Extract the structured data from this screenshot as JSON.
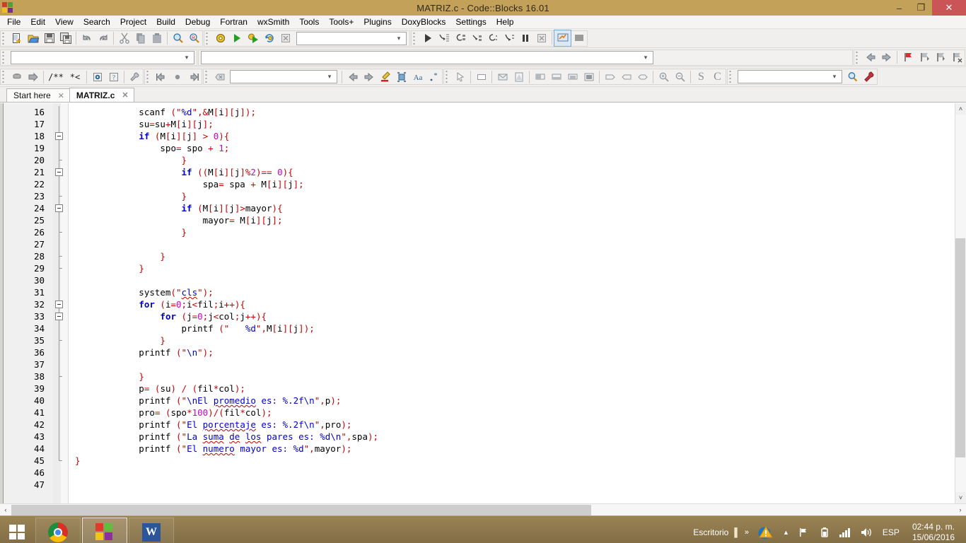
{
  "window": {
    "title": "MATRIZ.c - Code::Blocks 16.01",
    "logo_icon": "codeblocks-logo-icon",
    "minimize": "–",
    "maximize": "❐",
    "close": "✕",
    "titlebar_color": "#c3a158",
    "close_color": "#cb5456"
  },
  "menubar": {
    "items": [
      {
        "label": "File"
      },
      {
        "label": "Edit"
      },
      {
        "label": "View"
      },
      {
        "label": "Search"
      },
      {
        "label": "Project"
      },
      {
        "label": "Build"
      },
      {
        "label": "Debug"
      },
      {
        "label": "Fortran"
      },
      {
        "label": "wxSmith"
      },
      {
        "label": "Tools"
      },
      {
        "label": "Tools+"
      },
      {
        "label": "Plugins"
      },
      {
        "label": "DoxyBlocks"
      },
      {
        "label": "Settings"
      },
      {
        "label": "Help"
      }
    ]
  },
  "toolbars": {
    "row1": {
      "file_buttons": [
        "new-file-icon",
        "open-file-icon",
        "save-icon",
        "save-all-icon"
      ],
      "undo_buttons": [
        "undo-icon",
        "redo-icon"
      ],
      "clipboard_buttons": [
        "cut-icon",
        "copy-icon",
        "paste-icon"
      ],
      "find_buttons": [
        "find-icon",
        "replace-icon"
      ],
      "build_buttons": [
        "build-icon",
        "run-icon",
        "build-and-run-icon",
        "rebuild-icon",
        "abort-icon"
      ],
      "target_combo_value": "",
      "debug_buttons": [
        "debug-continue-icon",
        "debug-run-to-cursor-icon",
        "debug-next-line-icon",
        "debug-step-into-icon",
        "debug-step-out-icon",
        "debug-next-instruction-icon",
        "debug-break-icon",
        "debug-stop-icon",
        "debugging-windows-icon",
        "various-info-icon"
      ]
    },
    "row2": {
      "scope_combo_value": "",
      "nav_buttons": [
        "back-icon",
        "forward-icon"
      ],
      "bookmark_buttons": [
        "toggle-bookmark-icon",
        "previous-bookmark-icon",
        "next-bookmark-icon",
        "clear-bookmarks-icon"
      ]
    },
    "row3": {
      "doxy_buttons": [
        "doxyblocks-run-icon",
        "doxyblocks-extract-icon"
      ],
      "comment_buttons": [
        "block-comment-icon",
        "stream-comment-icon"
      ],
      "doc_buttons": [
        "doxywizard-icon",
        "doxyblocks-help-icon"
      ],
      "config_button": "doxyblocks-config-icon",
      "fortran_buttons": [
        "goto-prev-icon",
        "jump-icon",
        "goto-next-icon"
      ],
      "clear_button": "clear-icon",
      "fortran_combo_value": "",
      "nav2_buttons": [
        "prev-icon",
        "next-icon",
        "highlight-icon",
        "select-icon",
        "case-icon",
        "regex-icon"
      ],
      "wxsmith_buttons": [
        "pointer-icon",
        "panel-icon",
        "dialog-icon",
        "frame-icon",
        "sizer-h-icon",
        "sizer-v-icon",
        "sizer-grid-icon",
        "sizer-box-icon",
        "shape-1-icon",
        "shape-2-icon",
        "shape-3-icon"
      ],
      "zoom_buttons": [
        "zoom-in-icon",
        "zoom-out-icon"
      ],
      "lang_buttons": [
        "s-button",
        "c-button"
      ],
      "search_combo_value": "",
      "search_buttons": [
        "search-icon",
        "settings-wrench-icon"
      ]
    }
  },
  "tabs": [
    {
      "label": "Start here",
      "active": false,
      "close_glyph": "✕"
    },
    {
      "label": "MATRIZ.c",
      "active": true,
      "close_glyph": "✕"
    }
  ],
  "editor": {
    "first_line": 16,
    "last_line": 47,
    "lines": [
      {
        "n": 16,
        "fold": "line",
        "indent": 3,
        "tokens": [
          {
            "t": "scanf ",
            "c": "plain"
          },
          {
            "t": "(",
            "c": "pun"
          },
          {
            "t": "\"%d\"",
            "c": "str"
          },
          {
            "t": ",",
            "c": "pun"
          },
          {
            "t": "&M",
            "c": "plain"
          },
          {
            "t": "[",
            "c": "pun"
          },
          {
            "t": "i",
            "c": "plain"
          },
          {
            "t": "]",
            "c": "pun"
          },
          {
            "t": "[",
            "c": "pun"
          },
          {
            "t": "j",
            "c": "plain"
          },
          {
            "t": "]",
            "c": "pun"
          },
          {
            "t": ")",
            ",c": "pun"
          },
          {
            "t": ";",
            "c": "pun"
          }
        ],
        "text": "scanf (\"%d\",&M[i][j]);"
      },
      {
        "n": 17,
        "fold": "line",
        "indent": 3,
        "text": "su=su+M[i][j];"
      },
      {
        "n": 18,
        "fold": "box",
        "indent": 3,
        "text": "if (M[i][j] > 0){"
      },
      {
        "n": 19,
        "fold": "line",
        "indent": 4,
        "text": "spo= spo + 1;"
      },
      {
        "n": 20,
        "fold": "tick",
        "indent": 5,
        "text": "}"
      },
      {
        "n": 21,
        "fold": "box",
        "indent": 5,
        "text": "if ((M[i][j]%2)== 0){"
      },
      {
        "n": 22,
        "fold": "line",
        "indent": 6,
        "text": "spa= spa + M[i][j];"
      },
      {
        "n": 23,
        "fold": "tick",
        "indent": 5,
        "text": "}"
      },
      {
        "n": 24,
        "fold": "box",
        "indent": 5,
        "text": "if (M[i][j]>mayor){"
      },
      {
        "n": 25,
        "fold": "line",
        "indent": 6,
        "text": "mayor= M[i][j];"
      },
      {
        "n": 26,
        "fold": "tick",
        "indent": 5,
        "text": "}"
      },
      {
        "n": 27,
        "fold": "line",
        "indent": 0,
        "text": ""
      },
      {
        "n": 28,
        "fold": "tick",
        "indent": 4,
        "text": "}"
      },
      {
        "n": 29,
        "fold": "tick",
        "indent": 3,
        "text": "}"
      },
      {
        "n": 30,
        "fold": "line",
        "indent": 0,
        "text": ""
      },
      {
        "n": 31,
        "fold": "line",
        "indent": 3,
        "text": "system(\"cls\");"
      },
      {
        "n": 32,
        "fold": "box",
        "indent": 3,
        "text": "for (i=0;i<fil;i++){"
      },
      {
        "n": 33,
        "fold": "box",
        "indent": 4,
        "text": "for (j=0;j<col;j++){"
      },
      {
        "n": 34,
        "fold": "line",
        "indent": 5,
        "text": "printf (\"   %d\",M[i][j]);"
      },
      {
        "n": 35,
        "fold": "tick",
        "indent": 4,
        "text": "}"
      },
      {
        "n": 36,
        "fold": "line",
        "indent": 3,
        "text": "printf (\"\\n\");"
      },
      {
        "n": 37,
        "fold": "line",
        "indent": 0,
        "text": ""
      },
      {
        "n": 38,
        "fold": "tick",
        "indent": 3,
        "text": "}"
      },
      {
        "n": 39,
        "fold": "line",
        "indent": 3,
        "text": "p= (su) / (fil*col);"
      },
      {
        "n": 40,
        "fold": "line",
        "indent": 3,
        "text": "printf (\"\\nEl promedio es: %.2f\\n\",p);"
      },
      {
        "n": 41,
        "fold": "line",
        "indent": 3,
        "text": "pro= (spo*100)/(fil*col);"
      },
      {
        "n": 42,
        "fold": "line",
        "indent": 3,
        "text": "printf (\"El porcentaje es: %.2f\\n\",pro);"
      },
      {
        "n": 43,
        "fold": "line",
        "indent": 3,
        "text": "printf (\"La suma de los pares es: %d\\n\",spa);"
      },
      {
        "n": 44,
        "fold": "line",
        "indent": 3,
        "text": "printf (\"El numero mayor es: %d\",mayor);"
      },
      {
        "n": 45,
        "fold": "end",
        "indent": 0,
        "text": "}"
      },
      {
        "n": 46,
        "fold": "none",
        "indent": 0,
        "text": ""
      },
      {
        "n": 47,
        "fold": "none",
        "indent": 0,
        "text": ""
      }
    ],
    "colors": {
      "keyword": "#0000cc",
      "string": "#0000cc",
      "punctuation": "#cc0000",
      "number": "#cc00cc",
      "plain": "#000000",
      "background": "#ffffff",
      "gutter_background": "#f0f0f0"
    }
  },
  "scrollbars": {
    "v_up": "˄",
    "v_down": "˅",
    "h_left": "‹",
    "h_right": "›"
  },
  "taskbar": {
    "start_label": "start-button",
    "items": [
      {
        "name": "chrome",
        "icon": "google-chrome-icon",
        "active": false
      },
      {
        "name": "codeblocks",
        "icon": "codeblocks-icon",
        "active": true
      },
      {
        "name": "word",
        "icon": "microsoft-word-icon",
        "active": false,
        "glyph": "W"
      }
    ],
    "tray": {
      "desktop_label": "Escritorio",
      "overflow_glyph": "»",
      "show_hidden_glyph": "▲",
      "action_center_icon": "action-center-warning-icon",
      "network_icon": "network-icon",
      "battery_icon": "battery-icon",
      "signal_icon": "signal-bars-icon",
      "volume_icon": "volume-icon",
      "language": "ESP",
      "time": "02:44 p. m.",
      "date": "15/06/2016"
    }
  }
}
